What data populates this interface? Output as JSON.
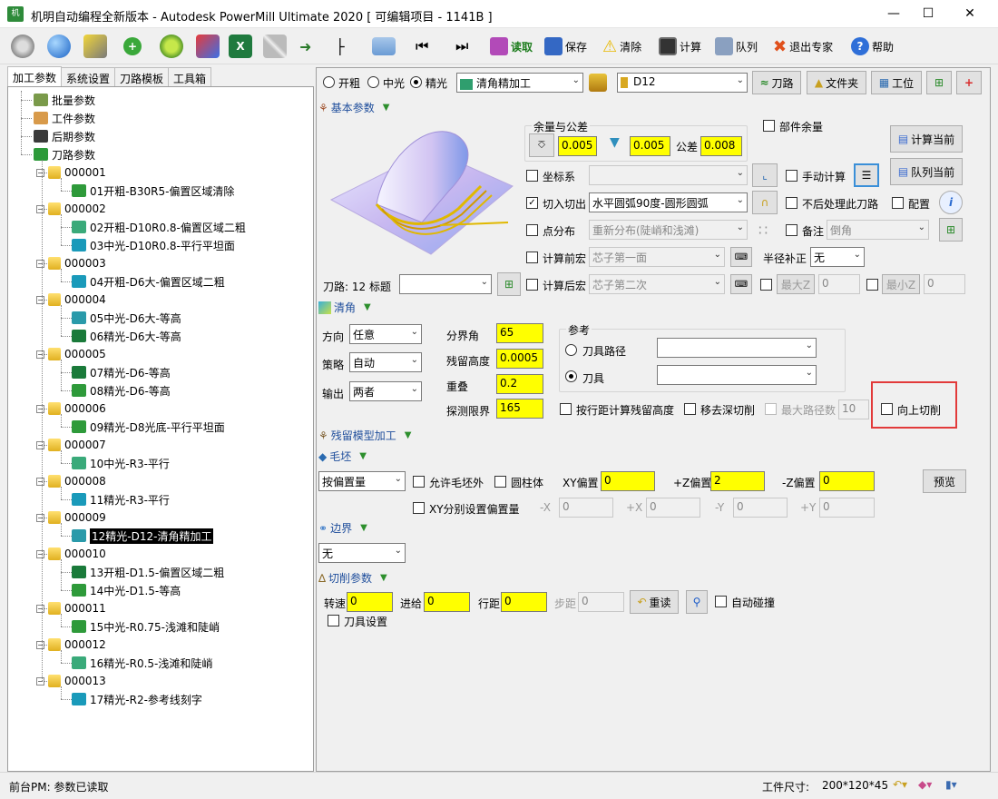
{
  "window": {
    "title": "机明自动编程全新版本 - Autodesk PowerMill Ultimate 2020    [ 可编辑项目 - 1141B ]"
  },
  "toolbar": {
    "read": "读取",
    "save": "保存",
    "clear": "清除",
    "calc": "计算",
    "queue": "队列",
    "exit": "退出专家",
    "help": "帮助"
  },
  "left_tabs": [
    "加工参数",
    "系统设置",
    "刀路模板",
    "工具箱"
  ],
  "tree": {
    "top": [
      "批量参数",
      "工件参数",
      "后期参数",
      "刀路参数"
    ],
    "groups": [
      {
        "id": "000001",
        "items": [
          "01开粗-B30R5-偏置区域清除"
        ]
      },
      {
        "id": "000002",
        "items": [
          "02开粗-D10R0.8-偏置区域二粗",
          "03中光-D10R0.8-平行平坦面"
        ]
      },
      {
        "id": "000003",
        "items": [
          "04开粗-D6大-偏置区域二粗"
        ]
      },
      {
        "id": "000004",
        "items": [
          "05中光-D6大-等高",
          "06精光-D6大-等高"
        ]
      },
      {
        "id": "000005",
        "items": [
          "07精光-D6-等高",
          "08精光-D6-等高"
        ]
      },
      {
        "id": "000006",
        "items": [
          "09精光-D8光底-平行平坦面"
        ]
      },
      {
        "id": "000007",
        "items": [
          "10中光-R3-平行"
        ]
      },
      {
        "id": "000008",
        "items": [
          "11精光-R3-平行"
        ]
      },
      {
        "id": "000009",
        "items": [
          "12精光-D12-清角精加工"
        ]
      },
      {
        "id": "000010",
        "items": [
          "13开粗-D1.5-偏置区域二粗",
          "14中光-D1.5-等高"
        ]
      },
      {
        "id": "000011",
        "items": [
          "15中光-R0.75-浅滩和陡峭"
        ]
      },
      {
        "id": "000012",
        "items": [
          "16精光-R0.5-浅滩和陡峭"
        ]
      },
      {
        "id": "000013",
        "items": [
          "17精光-R2-参考线刻字"
        ]
      }
    ],
    "selected": "12精光-D12-清角精加工"
  },
  "top_row": {
    "r1": "开粗",
    "r2": "中光",
    "r3": "精光",
    "strategy": "清角精加工",
    "tool": "D12",
    "btn_path": "刀路",
    "btn_folder": "文件夹",
    "btn_workpos": "工位"
  },
  "basic": {
    "section": "基本参数",
    "allowance_group": "余量与公差",
    "allow1": "0.005",
    "allow2": "0.005",
    "tol_label": "公差",
    "tol": "0.008",
    "part_allowance": "部件余量",
    "calc_current": "计算当前",
    "queue_current": "队列当前",
    "coord": "坐标系",
    "manual_calc": "手动计算",
    "leadin": "切入切出",
    "leadin_val": "水平圆弧90度-圆形圆弧",
    "no_post": "不后处理此刀路",
    "config": "配置",
    "point_dist": "点分布",
    "point_dist_val": "重新分布(陡峭和浅滩)",
    "note": "备注",
    "note_val": "倒角",
    "pre_macro": "计算前宏",
    "pre_macro_val": "芯子第一面",
    "radius_comp": "半径补正",
    "radius_comp_val": "无",
    "post_macro": "计算后宏",
    "post_macro_val": "芯子第二次",
    "maxz": "最大Z",
    "maxz_val": "0",
    "minz": "最小Z",
    "minz_val": "0",
    "toolpath_label": "刀路: 12  标题"
  },
  "corner": {
    "section": "清角",
    "dir": "方向",
    "dir_val": "任意",
    "strategy": "策略",
    "strategy_val": "自动",
    "output": "输出",
    "output_val": "两者",
    "angle": "分界角",
    "angle_val": "65",
    "cusp": "残留高度",
    "cusp_val": "0.0005",
    "overlap": "重叠",
    "overlap_val": "0.2",
    "probe": "探测限界",
    "probe_val": "165",
    "ref": "参考",
    "ref_path": "刀具路径",
    "ref_tool": "刀具",
    "stepover_cusp": "按行距计算残留高度",
    "remove_deep": "移去深切削",
    "max_route": "最大路径数",
    "max_route_val": "10",
    "up_cut": "向上切削"
  },
  "rest": {
    "section": "残留模型加工"
  },
  "stock": {
    "section": "毛坯",
    "mode": "按偏置量",
    "allow_outside": "允许毛坯外",
    "cylinder": "圆柱体",
    "xy_off": "XY偏置",
    "xy_off_val": "0",
    "pz_off": "+Z偏置",
    "pz_off_val": "2",
    "nz_off": "-Z偏置",
    "nz_off_val": "0",
    "preview": "预览",
    "xy_separate": "XY分别设置偏置量",
    "mx": "-X",
    "mx_val": "0",
    "px": "+X",
    "px_val": "0",
    "my": "-Y",
    "my_val": "0",
    "py": "+Y",
    "py_val": "0"
  },
  "boundary": {
    "section": "边界",
    "value": "无"
  },
  "cutting": {
    "section": "切削参数",
    "speed": "转速",
    "speed_val": "0",
    "feed": "进给",
    "feed_val": "0",
    "stepover": "行距",
    "stepover_val": "0",
    "stepdown": "步距",
    "stepdown_val": "0",
    "reread": "重读",
    "auto_collision": "自动碰撞",
    "tool_settings": "刀具设置"
  },
  "status": {
    "left": "前台PM: 参数已读取",
    "size_label": "工件尺寸:",
    "size_val": "200*120*45"
  },
  "colors": {
    "accent_yellow": "#ffff00",
    "section_blue": "#1f4e9c",
    "highlight_red": "#e23a3a"
  }
}
